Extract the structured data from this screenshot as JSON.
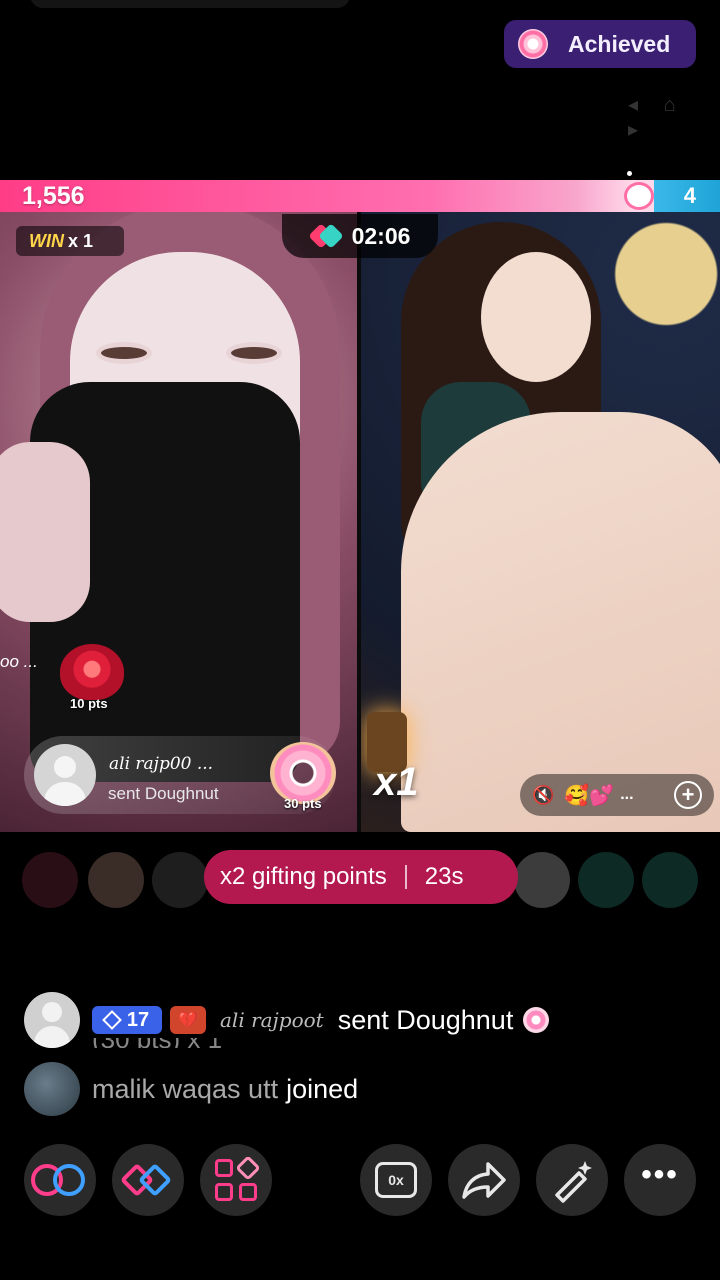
{
  "header": {
    "achieved_label": "Achieved"
  },
  "battle": {
    "left_score": "1,556",
    "right_score": "4",
    "win_label": "WIN",
    "win_count": "x 1",
    "timer": "02:06",
    "right_multiplier": "x1",
    "left_gift": {
      "truncated_user": "oo ...",
      "gift_points": "10 pts"
    },
    "gift_banner": {
      "user": "ali rajp00 ...",
      "action": "sent Doughnut",
      "points": "30 pts"
    },
    "controls": {
      "dots": "..."
    }
  },
  "boost": {
    "label": "x2 gifting points",
    "countdown": "23s"
  },
  "chat": {
    "messages": [
      {
        "level": "17",
        "user": "ali rajpoot",
        "text": "sent Doughnut",
        "overflow": "(30 pts) x 1"
      }
    ],
    "join": {
      "user": "malik waqas utt",
      "text": "joined"
    }
  },
  "toolbar": {
    "message_icon_text": "0x"
  },
  "colors": {
    "score_bar": "#ff3d87",
    "opponent_bar": "#1fa4d8",
    "boost_pill": "#b3194f",
    "achieved_bg": "#3a1f72",
    "level_badge": "#3a62e8"
  }
}
